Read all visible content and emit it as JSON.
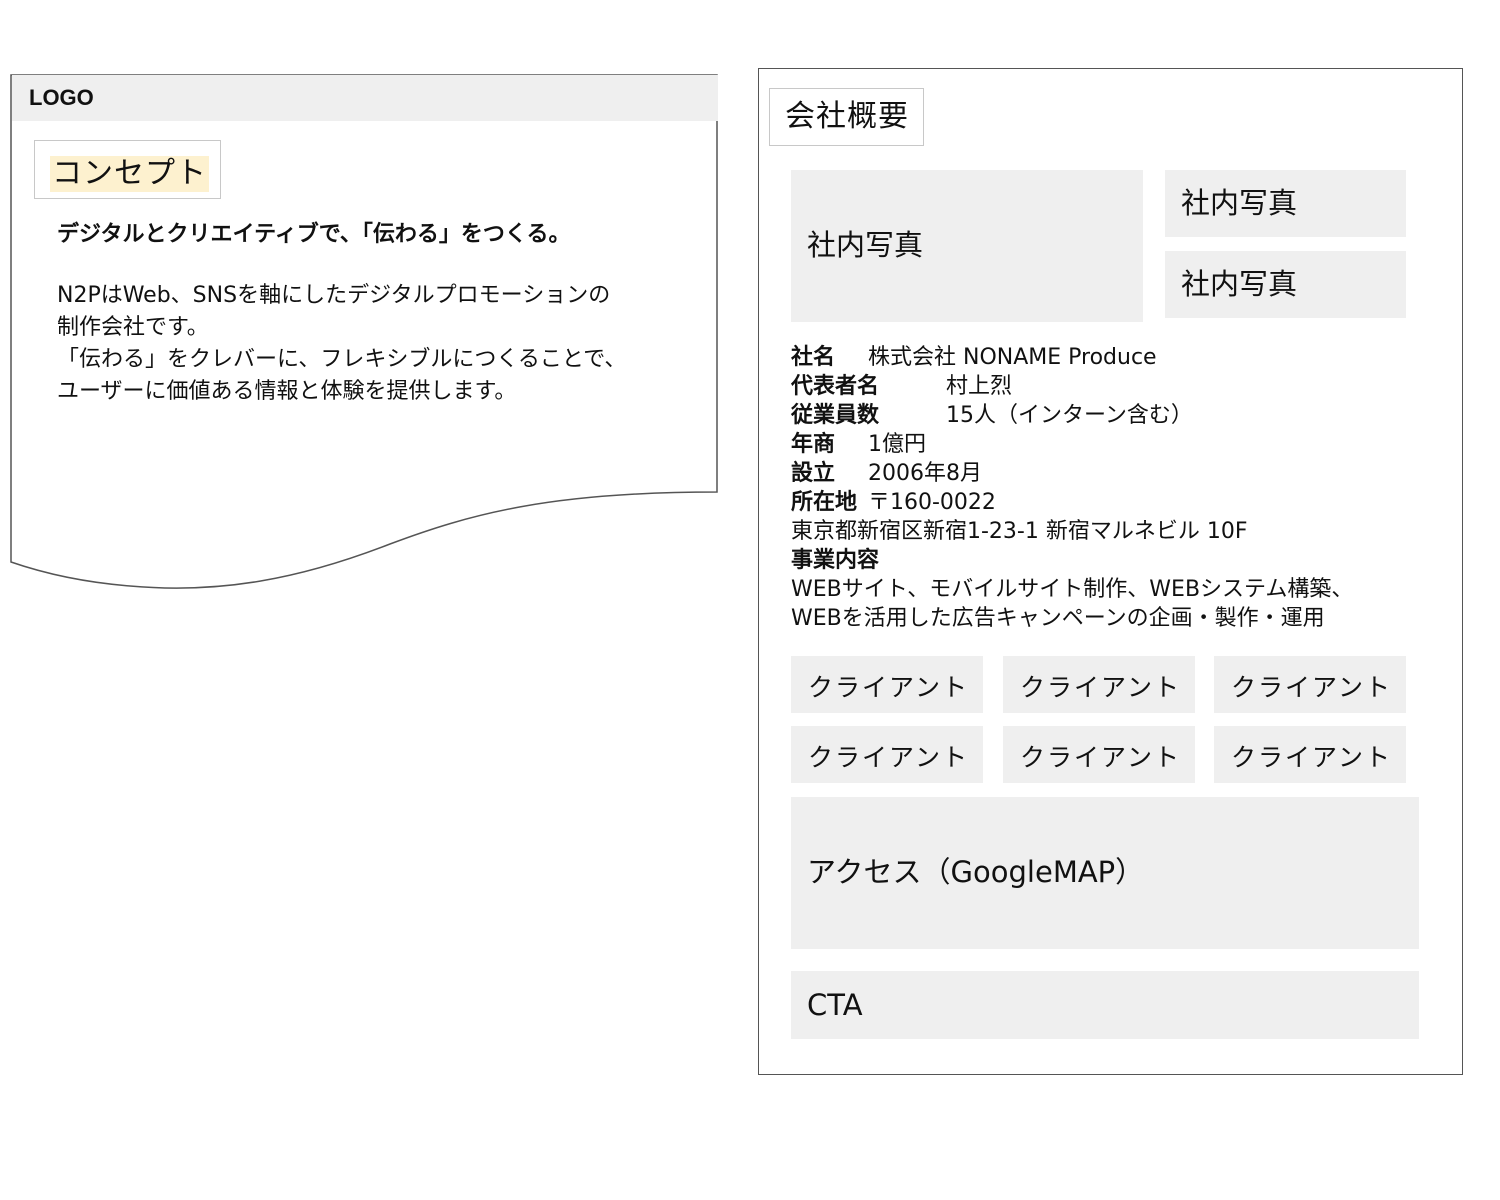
{
  "left": {
    "logo": "LOGO",
    "concept_label": "コンセプト",
    "heading": "デジタルとクリエイティブで、「伝わる」をつくる。",
    "body_lines": [
      "N2PはWeb、SNSを軸にしたデジタルプロモーションの",
      "制作会社です。",
      "「伝わる」をクレバーに、フレキシブルにつくることで、",
      "ユーザーに価値ある情報と体験を提供します。"
    ]
  },
  "right": {
    "section_title": "会社概要",
    "photos": [
      "社内写真",
      "社内写真",
      "社内写真"
    ],
    "company_info": [
      {
        "key": "社名",
        "value": "株式会社 NONAME Produce"
      },
      {
        "key": "代表者名",
        "value": "村上烈"
      },
      {
        "key": "従業員数",
        "value": "15人（インターン含む）"
      },
      {
        "key": "年商",
        "value": "1億円"
      },
      {
        "key": "設立",
        "value": "2006年8月"
      },
      {
        "key": "所在地",
        "value": "〒160-0022"
      },
      {
        "line": "東京都新宿区新宿1-23-1 新宿マルネビル 10F"
      },
      {
        "key": "事業内容",
        "value": ""
      },
      {
        "line": "WEBサイト、モバイルサイト制作、WEBシステム構築、"
      },
      {
        "line": "WEBを活用した広告キャンペーンの企画・製作・運用"
      }
    ],
    "clients": [
      "クライアント",
      "クライアント",
      "クライアント",
      "クライアント",
      "クライアント",
      "クライアント"
    ],
    "access": "アクセス（GoogleMAP）",
    "cta": "CTA"
  },
  "colors": {
    "block_gray": "#efefef",
    "highlight": "#fdf1cf",
    "border": "#555555"
  }
}
